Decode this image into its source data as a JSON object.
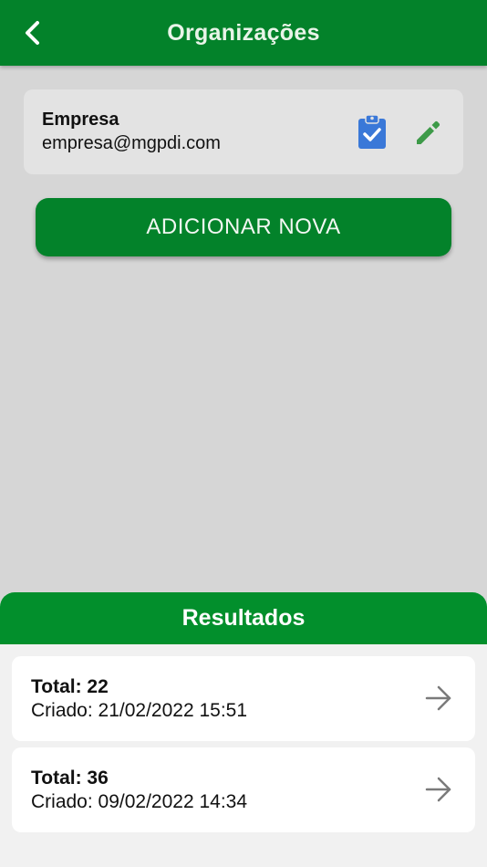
{
  "app_bar": {
    "title": "Organizações",
    "back_icon": "chevron-left-icon"
  },
  "organization": {
    "name": "Empresa",
    "email": "empresa@mgpdi.com",
    "clipboard_icon": "clipboard-check-icon",
    "edit_icon": "pencil-icon"
  },
  "add_button": {
    "label": "ADICIONAR NOVA"
  },
  "results": {
    "title": "Resultados",
    "items": [
      {
        "total": "Total: 22",
        "created": "Criado: 21/02/2022 15:51"
      },
      {
        "total": "Total: 36",
        "created": "Criado: 09/02/2022 14:34"
      }
    ]
  },
  "colors": {
    "primary_green": "#03822a",
    "results_header_green": "#028f2c",
    "background": "#d6d6d6",
    "clipboard_blue": "#3a78d8",
    "pencil_green": "#3d9a48"
  }
}
